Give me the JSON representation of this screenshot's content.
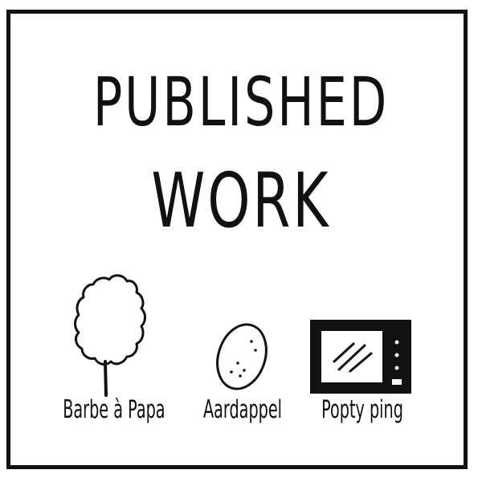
{
  "title": {
    "line1": "PUBLISHED",
    "line2": "WORK"
  },
  "items": [
    {
      "label": "Barbe à Papa",
      "icon": "cotton-candy-icon"
    },
    {
      "label": "Aardappel",
      "icon": "potato-icon"
    },
    {
      "label": "Popty ping",
      "icon": "microwave-icon"
    }
  ],
  "colors": {
    "ink": "#111111",
    "background": "#ffffff"
  }
}
